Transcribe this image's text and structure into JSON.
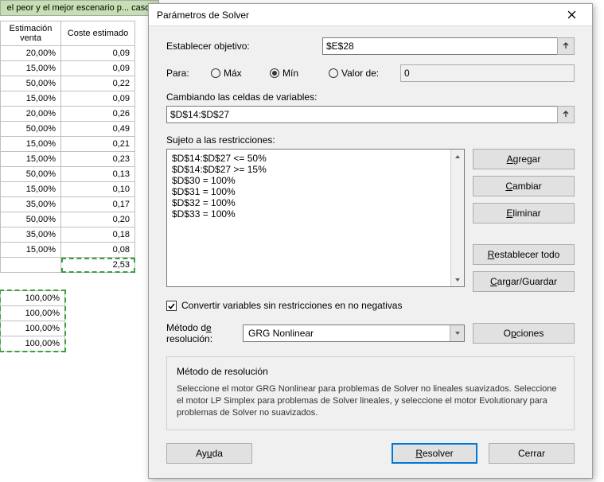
{
  "sheet": {
    "banner": "el peor y el mejor escenario p... caso.",
    "col1_header": "Estimación venta",
    "col2_header": "Coste estimado",
    "rows": [
      {
        "est": "20,00%",
        "cost": "0,09"
      },
      {
        "est": "15,00%",
        "cost": "0,09"
      },
      {
        "est": "50,00%",
        "cost": "0,22"
      },
      {
        "est": "15,00%",
        "cost": "0,09"
      },
      {
        "est": "20,00%",
        "cost": "0,26"
      },
      {
        "est": "50,00%",
        "cost": "0,49"
      },
      {
        "est": "15,00%",
        "cost": "0,21"
      },
      {
        "est": "15,00%",
        "cost": "0,23"
      },
      {
        "est": "50,00%",
        "cost": "0,13"
      },
      {
        "est": "15,00%",
        "cost": "0,10"
      },
      {
        "est": "35,00%",
        "cost": "0,17"
      },
      {
        "est": "50,00%",
        "cost": "0,20"
      },
      {
        "est": "35,00%",
        "cost": "0,18"
      },
      {
        "est": "15,00%",
        "cost": "0,08"
      }
    ],
    "total": "2,53",
    "sum_rows": [
      "100,00%",
      "100,00%",
      "100,00%",
      "100,00%"
    ]
  },
  "dialog": {
    "title": "Parámetros de Solver",
    "set_objective_label": "Establecer objetivo:",
    "objective_cell": "$E$28",
    "to_label": "Para:",
    "opt_max": "Máx",
    "opt_min": "Mín",
    "opt_value": "Valor de:",
    "value_of": "0",
    "changing_label": "Cambiando las celdas de variables:",
    "changing_cells": "$D$14:$D$27",
    "constraints_label": "Sujeto a las restricciones:",
    "constraints": [
      "$D$14:$D$27 <= 50%",
      "$D$14:$D$27 >= 15%",
      "$D$30 = 100%",
      "$D$31 = 100%",
      "$D$32 = 100%",
      "$D$33 = 100%"
    ],
    "btn_add": "Agregar",
    "btn_change": "Cambiar",
    "btn_delete": "Eliminar",
    "btn_reset": "Restablecer todo",
    "btn_loadsave": "Cargar/Guardar",
    "nonneg_label": "Convertir variables sin restricciones en no negativas",
    "method_label_1": "Método de",
    "method_label_2": "resolución:",
    "method_value": "GRG Nonlinear",
    "btn_options": "Opciones",
    "group_title": "Método de resolución",
    "group_text": "Seleccione el motor GRG Nonlinear para problemas de Solver no lineales suavizados. Seleccione el motor LP Simplex para problemas de Solver lineales, y seleccione el motor Evolutionary para problemas de Solver no suavizados.",
    "btn_help": "Ayuda",
    "btn_solve": "Resolver",
    "btn_close": "Cerrar"
  }
}
